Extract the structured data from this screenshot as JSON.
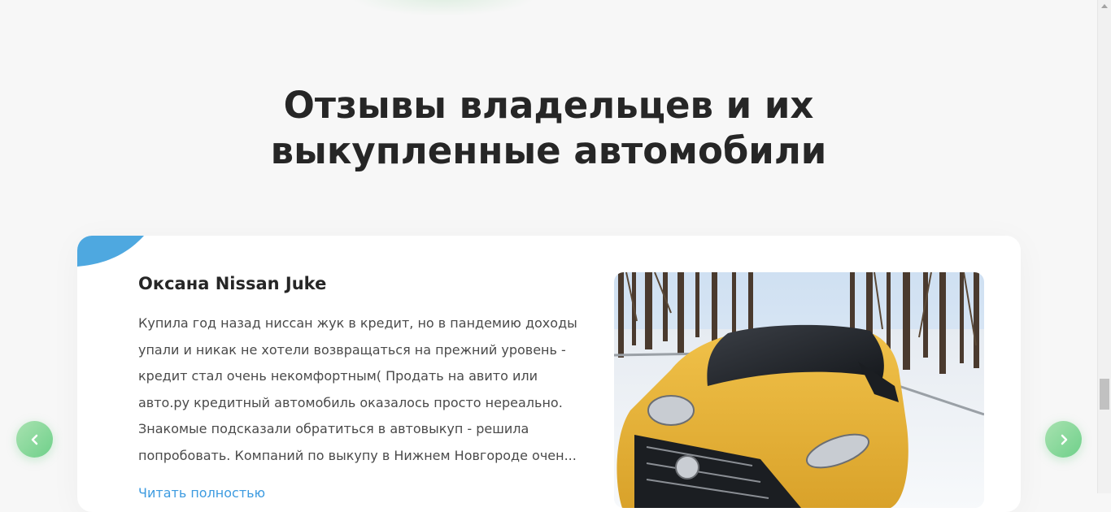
{
  "section": {
    "title_line1": "Отзывы владельцев и их",
    "title_line2": "выкупленные автомобили"
  },
  "review": {
    "name": "Оксана Nissan Juke",
    "text": "Купила год назад ниссан жук в кредит, но в пандемию доходы упали и никак не хотели возвращаться на прежний уровень - кредит стал очень некомфортным( Продать на авито или авто.ру кредитный автомобиль оказалось просто нереально. Знакомые подсказали обратиться в автовыкуп - решила попробовать. Компаний по выкупу в Нижнем Новгороде очен...",
    "read_more": "Читать полностью",
    "photo_icon": "car-photo"
  },
  "navigation": {
    "prev_icon": "chevron-left-icon",
    "next_icon": "chevron-right-icon"
  },
  "colors": {
    "accent_green": "#6fd08a",
    "accent_blue": "#4ea8e0",
    "car_yellow": "#e8b83a"
  }
}
